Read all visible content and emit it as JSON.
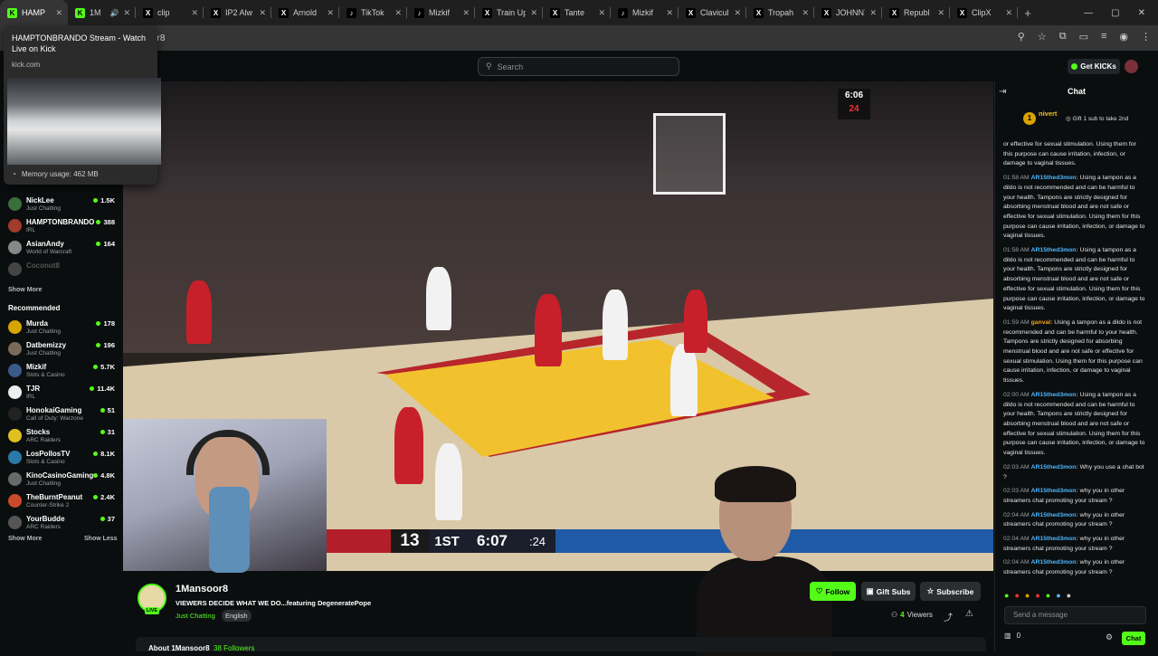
{
  "tabs": [
    {
      "label": "HAMP",
      "fav": "K",
      "color": "#53fc18",
      "active": true
    },
    {
      "label": "1M",
      "fav": "K",
      "color": "#53fc18",
      "active": false,
      "audio": true
    },
    {
      "label": "clip",
      "fav": "X",
      "color": "#000000",
      "active": false
    },
    {
      "label": "IP2 Alw",
      "fav": "X",
      "color": "#000000",
      "active": false
    },
    {
      "label": "Arnold",
      "fav": "X",
      "color": "#000000",
      "active": false
    },
    {
      "label": "TikTok",
      "fav": "♪",
      "color": "#000000",
      "active": false
    },
    {
      "label": "Mizkif",
      "fav": "♪",
      "color": "#000000",
      "active": false
    },
    {
      "label": "Train Up",
      "fav": "X",
      "color": "#000000",
      "active": false
    },
    {
      "label": "Tante",
      "fav": "X",
      "color": "#000000",
      "active": false
    },
    {
      "label": "Mizkif",
      "fav": "♪",
      "color": "#000000",
      "active": false
    },
    {
      "label": "Clavicul",
      "fav": "X",
      "color": "#000000",
      "active": false
    },
    {
      "label": "Tropah",
      "fav": "X",
      "color": "#000000",
      "active": false
    },
    {
      "label": "JOHNNY",
      "fav": "X",
      "color": "#000000",
      "active": false
    },
    {
      "label": "Republ",
      "fav": "X",
      "color": "#000000",
      "active": false
    },
    {
      "label": "ClipX",
      "fav": "X",
      "color": "#000000",
      "active": false
    }
  ],
  "browser": {
    "new_tab": "+",
    "omnibox_text": "or8",
    "window_controls": [
      "—",
      "▢",
      "✕"
    ]
  },
  "tab_tooltip": {
    "title": "HAMPTONBRANDO Stream - Watch Live on Kick",
    "url": "kick.com",
    "memory": "Memory usage: 462 MB"
  },
  "header": {
    "search_placeholder": "Search",
    "get_kicks": "Get KICKs"
  },
  "sidebar": {
    "following": [
      {
        "name": "NickLee",
        "category": "Just Chatting",
        "count": "1.5K",
        "color": "#3a6e3a"
      },
      {
        "name": "HAMPTONBRANDO",
        "category": "IRL",
        "count": "388",
        "color": "#a13b2a"
      },
      {
        "name": "AsianAndy",
        "category": "World of Warcraft",
        "count": "164",
        "color": "#888888"
      },
      {
        "name": "Coconut8",
        "category": "",
        "count": "",
        "color": "#444444"
      }
    ],
    "show_more_1": "Show More",
    "recommended_title": "Recommended",
    "recommended": [
      {
        "name": "Murda",
        "category": "Just Chatting",
        "count": "178",
        "color": "#d8a400"
      },
      {
        "name": "Datbemizzy",
        "category": "Just Chatting",
        "count": "196",
        "color": "#7a6a5a"
      },
      {
        "name": "Mizkif",
        "category": "Slots & Casino",
        "count": "5.7K",
        "color": "#3a5a8a"
      },
      {
        "name": "TJR",
        "category": "IRL",
        "count": "11.4K",
        "color": "#eeeeee"
      },
      {
        "name": "HonokaiGaming",
        "category": "Call of Duty: Warzone",
        "count": "51",
        "color": "#222222"
      },
      {
        "name": "Stocks",
        "category": "ARC Raiders",
        "count": "31",
        "color": "#e0c020"
      },
      {
        "name": "LosPollosTV",
        "category": "Slots & Casino",
        "count": "8.1K",
        "color": "#2a7aa8"
      },
      {
        "name": "KinoCasinoGaming",
        "category": "Just Chatting",
        "count": "4.8K",
        "color": "#6a6a6a"
      },
      {
        "name": "TheBurntPeanut",
        "category": "Counter-Strike 2",
        "count": "2.4K",
        "color": "#c84a2a"
      },
      {
        "name": "YourBudde",
        "category": "ARC Raiders",
        "count": "37",
        "color": "#555555"
      }
    ],
    "show_more_2": "Show More",
    "show_less": "Show Less"
  },
  "video": {
    "score_home": "13",
    "quarter": "1ST",
    "clock": "6:07",
    "shot_clock": ":24",
    "game_clock_top": "6:06",
    "shot_clock_top": "24"
  },
  "stream": {
    "name": "1Mansoor8",
    "title": "VIEWERS DECIDE WHAT WE DO...featuring DegeneratePope",
    "category": "Just Chatting",
    "language": "English",
    "live_label": "LIVE",
    "follow": "Follow",
    "gift_subs": "Gift Subs",
    "subscribe": "Subscribe",
    "viewers_count": "4",
    "viewers_label": "Viewers",
    "about": "About 1Mansoor8",
    "followers": "38 Followers"
  },
  "chat": {
    "title": "Chat",
    "pinned_name": "nivert",
    "pinned_sub": "1",
    "pinned_gift": "Gift 1 sub to take 2nd",
    "messages": [
      {
        "time": "",
        "user": "",
        "color": "#4db6ff",
        "text": "or effective for sexual stimulation. Using them for this purpose can cause irritation, infection, or damage to vaginal tissues."
      },
      {
        "time": "01:58 AM",
        "user": "AR15thed3mon:",
        "color": "#4db6ff",
        "text": "Using a tampon as a dildo is not recommended and can be harmful to your health. Tampons are strictly designed for absorbing menstrual blood and are not safe or effective for sexual stimulation. Using them for this purpose can cause irritation, infection, or damage to vaginal tissues."
      },
      {
        "time": "01:58 AM",
        "user": "AR15thed3mon:",
        "color": "#4db6ff",
        "text": "Using a tampon as a dildo is not recommended and can be harmful to your health. Tampons are strictly designed for absorbing menstrual blood and are not safe or effective for sexual stimulation. Using them for this purpose can cause irritation, infection, or damage to vaginal tissues."
      },
      {
        "time": "01:59 AM",
        "user": "ganval:",
        "color": "#f0a020",
        "text": "Using a tampon as a dildo is not recommended and can be harmful to your health. Tampons are strictly designed for absorbing menstrual blood and are not safe or effective for sexual stimulation. Using them for this purpose can cause irritation, infection, or damage to vaginal tissues."
      },
      {
        "time": "02:00 AM",
        "user": "AR15thed3mon:",
        "color": "#4db6ff",
        "text": "Using a tampon as a dildo is not recommended and can be harmful to your health. Tampons are strictly designed for absorbing menstrual blood and are not safe or effective for sexual stimulation. Using them for this purpose can cause irritation, infection, or damage to vaginal tissues."
      },
      {
        "time": "02:03 AM",
        "user": "AR15thed3mon:",
        "color": "#4db6ff",
        "text": "Why you use a chat bot ?"
      },
      {
        "time": "02:03 AM",
        "user": "AR15thed3mon:",
        "color": "#4db6ff",
        "text": "why you in other streamers chat promoting your stream ?"
      },
      {
        "time": "02:04 AM",
        "user": "AR15thed3mon:",
        "color": "#4db6ff",
        "text": "why you in other streamers chat promoting your stream ?"
      },
      {
        "time": "02:04 AM",
        "user": "AR15thed3mon:",
        "color": "#4db6ff",
        "text": "why you in other streamers chat promoting your stream ?"
      },
      {
        "time": "02:04 AM",
        "user": "AR15thed3mon:",
        "color": "#4db6ff",
        "text": "why you in other streamers chat promoting your stream ?"
      }
    ],
    "input_placeholder": "Send a message",
    "kicks_balance": "0",
    "send": "Chat"
  }
}
